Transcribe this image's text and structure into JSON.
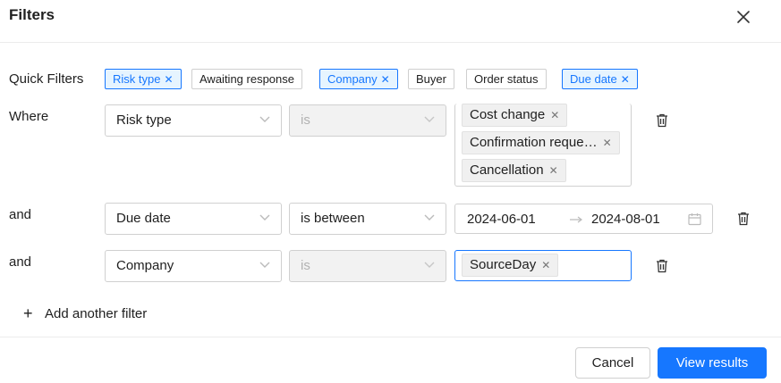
{
  "header": {
    "title": "Filters"
  },
  "quick_filters": {
    "label": "Quick Filters",
    "chips": [
      {
        "label": "Risk type",
        "active": true
      },
      {
        "label": "Awaiting response",
        "active": false
      },
      {
        "label": "Company",
        "active": true
      },
      {
        "label": "Buyer",
        "active": false
      },
      {
        "label": "Order status",
        "active": false
      },
      {
        "label": "Due date",
        "active": true
      }
    ]
  },
  "rows": [
    {
      "connector": "Where",
      "field": "Risk type",
      "operator": "is",
      "values": [
        "Cost change",
        "Confirmation reque…",
        "Cancellation"
      ]
    },
    {
      "connector": "and",
      "field": "Due date",
      "operator": "is between",
      "range": {
        "start": "2024-06-01",
        "end": "2024-08-01"
      }
    },
    {
      "connector": "and",
      "field": "Company",
      "operator": "is",
      "values": [
        "SourceDay"
      ]
    }
  ],
  "add_filter": {
    "label": "Add another filter"
  },
  "footer": {
    "cancel_label": "Cancel",
    "submit_label": "View results"
  },
  "icons": {
    "close": "close-icon",
    "chevron": "chevron-down-icon",
    "trash": "trash-icon",
    "calendar": "calendar-icon",
    "arrow": "arrow-right-icon",
    "plus": "plus-icon"
  },
  "colors": {
    "accent": "#1677ff",
    "accent_bg": "#e6f4ff",
    "disabled_bg": "#f2f2f2"
  }
}
